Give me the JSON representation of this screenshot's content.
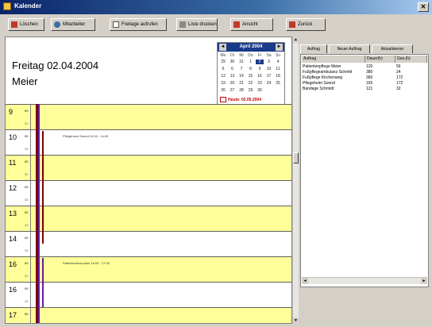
{
  "window": {
    "title": "Kalender"
  },
  "toolbar": {
    "buttons": [
      {
        "label": "Löschen",
        "icon": "delete-icon"
      },
      {
        "label": "Mitarbeiter",
        "icon": "user-icon"
      },
      {
        "label": "Freitage aufrufen",
        "icon": "calendar-icon"
      },
      {
        "label": "Liste drucken",
        "icon": "print-icon"
      },
      {
        "label": "Ansicht",
        "icon": "view-icon"
      },
      {
        "label": "Zurück",
        "icon": "back-icon"
      }
    ]
  },
  "day_view": {
    "date": "Freitag 02.04.2004",
    "employee": "Meier",
    "hours": [
      {
        "hour": "9",
        "min": "00",
        "half": "30",
        "highlight": true
      },
      {
        "hour": "10",
        "min": "00",
        "half": "30",
        "highlight": false
      },
      {
        "hour": "11",
        "min": "00",
        "half": "30",
        "highlight": true
      },
      {
        "hour": "12",
        "min": "00",
        "half": "30",
        "highlight": false
      },
      {
        "hour": "13",
        "min": "00",
        "half": "30",
        "highlight": true
      },
      {
        "hour": "14",
        "min": "00",
        "half": "30",
        "highlight": false
      },
      {
        "hour": "16",
        "min": "00",
        "half": "30",
        "highlight": true
      },
      {
        "hour": "16",
        "min": "00",
        "half": "30",
        "highlight": false
      },
      {
        "hour": "17",
        "min": "00",
        "half": "30",
        "highlight": true
      }
    ],
    "appointments": [
      {
        "text": "Pflegeheim Sonnd   10:00 - 14:00"
      },
      {
        "text": "Patientenbesuchen   16:00 - 17:30"
      }
    ]
  },
  "mini_calendar": {
    "title": "April 2004",
    "prev": "◄",
    "next": "►",
    "weekdays": [
      "Mo",
      "Di",
      "Mi",
      "Do",
      "Fr",
      "Sa",
      "So"
    ],
    "weeks": [
      [
        "29",
        "30",
        "31",
        "1",
        "2",
        "3",
        "4"
      ],
      [
        "5",
        "6",
        "7",
        "8",
        "9",
        "10",
        "11"
      ],
      [
        "12",
        "13",
        "14",
        "15",
        "16",
        "17",
        "18"
      ],
      [
        "19",
        "20",
        "21",
        "22",
        "23",
        "24",
        "25"
      ],
      [
        "26",
        "27",
        "28",
        "29",
        "30",
        "",
        ""
      ]
    ],
    "selected_day": "2",
    "today_label": "Heute: 02.05.2004"
  },
  "right_panel": {
    "tabs": [
      "Auftrag",
      "Neuer Auftrag",
      "Aktualisieren"
    ],
    "columns": [
      "Auftrag",
      "Dauer(h)",
      "Ges.(h)"
    ],
    "rows": [
      [
        "Patientenpflege Meier",
        "120",
        "56"
      ],
      [
        "Fußpflegeambulanz Schmitt",
        "380",
        "24"
      ],
      [
        "Fußpflege Kirchenweg",
        "360",
        "172"
      ],
      [
        "Pflegeheim Sonnd",
        "165",
        "172"
      ],
      [
        "Bandage Schmidt",
        "121",
        "32"
      ]
    ]
  },
  "colors": {
    "highlight": "#ffff99",
    "bar_primary": "#7a0000",
    "bar_secondary": "#6020a0",
    "accent": "#1a3a8a"
  }
}
